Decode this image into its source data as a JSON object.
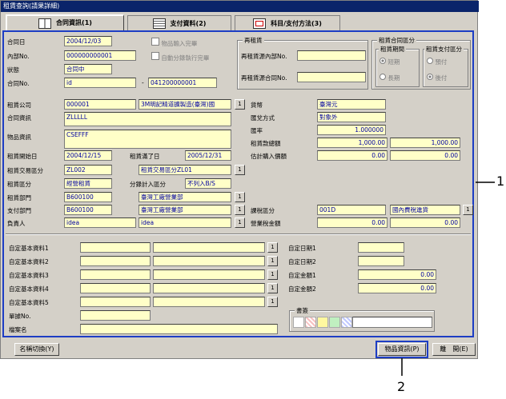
{
  "window": {
    "title": "租賃查詢(請果詳細)"
  },
  "tabs": [
    {
      "label": "合同資訊(1)",
      "icon": "book-icon"
    },
    {
      "label": "支付資料(2)",
      "icon": "bill-icon"
    },
    {
      "label": "科目/支付方法(3)",
      "icon": "document-icon"
    }
  ],
  "top": {
    "contract_date_label": "合同日",
    "contract_date": "2004/12/03",
    "internal_no_label": "內部No.",
    "internal_no": "000000000001",
    "status_label": "狀態",
    "status": "合同中",
    "contract_no_label": "合同No.",
    "contract_no_a": "id",
    "contract_no_sep": "-",
    "contract_no_b": "041200000001",
    "chk_item_input": "物品輸入完畢",
    "chk_auto_split": "自動分錄執行完畢"
  },
  "release": {
    "title": "再租賃",
    "internal_label": "再租賃源內部No.",
    "internal": "",
    "contract_label": "再租賃源合同No.",
    "contract": ""
  },
  "lease_type": {
    "title": "租賃合同區分",
    "period_title": "租賃期間",
    "period_short": "短期",
    "period_long": "長期",
    "pay_title": "租賃支付區分",
    "pay_prepaid": "預付",
    "pay_postpaid": "後付"
  },
  "main": {
    "lease_company_label": "租賃公司",
    "lease_company_code": "000001",
    "lease_company_name": "3M明記精道擴製造(臺灣)國",
    "contract_info_label": "合同資訊",
    "contract_info": "ZLLLLL",
    "item_info_label": "物品資訊",
    "item_info": "CSEFFF",
    "lease_start_label": "租賃開始日",
    "lease_start": "2004/12/15",
    "lease_end_label": "租賃滿了日",
    "lease_end": "2005/12/31",
    "trade_type_label": "租賃交易區分",
    "trade_type_code": "ZL002",
    "trade_type_name": "租賃交易區分ZL01",
    "lease_type_label": "租賃區分",
    "lease_type": "經營租賃",
    "split_label": "分錄計入區分",
    "split": "不列入B/S",
    "lease_dept_label": "租賃部門",
    "lease_dept_code": "B600100",
    "lease_dept_name": "臺灣工廠營業部",
    "pay_dept_label": "支付部門",
    "pay_dept_code": "B600100",
    "pay_dept_name": "臺灣工廠營業部",
    "owner_label": "負責人",
    "owner_code": "idea",
    "owner_name": "idea",
    "currency_label": "貨幣",
    "currency": "臺灣元",
    "fx_method_label": "匯兌方式",
    "fx_method": "對象外",
    "fx_rate_label": "匯率",
    "fx_rate": "1.000000",
    "total_label": "租賃款總額",
    "total_a": "1,000.00",
    "total_b": "1,000.00",
    "est_label": "估計購入價額",
    "est_a": "0.00",
    "est_b": "0.00",
    "tax_type_label": "課稅區分",
    "tax_type_code": "001D",
    "tax_type_name": "國內費稅進貨",
    "sales_tax_label": "營業稅金額",
    "sales_tax_a": "0.00",
    "sales_tax_b": "0.00"
  },
  "custom": {
    "basic_labels": [
      "自定基本資料1",
      "自定基本資料2",
      "自定基本資料3",
      "自定基本資料4",
      "自定基本資料5"
    ],
    "date_labels": [
      "自定日期1",
      "自定日期2"
    ],
    "amount_labels": [
      "自定金額1",
      "自定金額2"
    ],
    "amount_values": [
      "0.00",
      "0.00"
    ],
    "receipt_label": "單據No.",
    "filename_label": "檔案名",
    "books_title": "書簽"
  },
  "buttons": {
    "name_switch": "名稱切換(Y)",
    "item_info": "物品資訊(P)",
    "exit": "離　開(E)",
    "lookup": "1"
  },
  "callouts": {
    "one": "1",
    "two": "2"
  },
  "colors": {
    "title_bar": "#0a246a",
    "field_bg": "#ffffc8",
    "highlight": "#1d3dc4"
  }
}
